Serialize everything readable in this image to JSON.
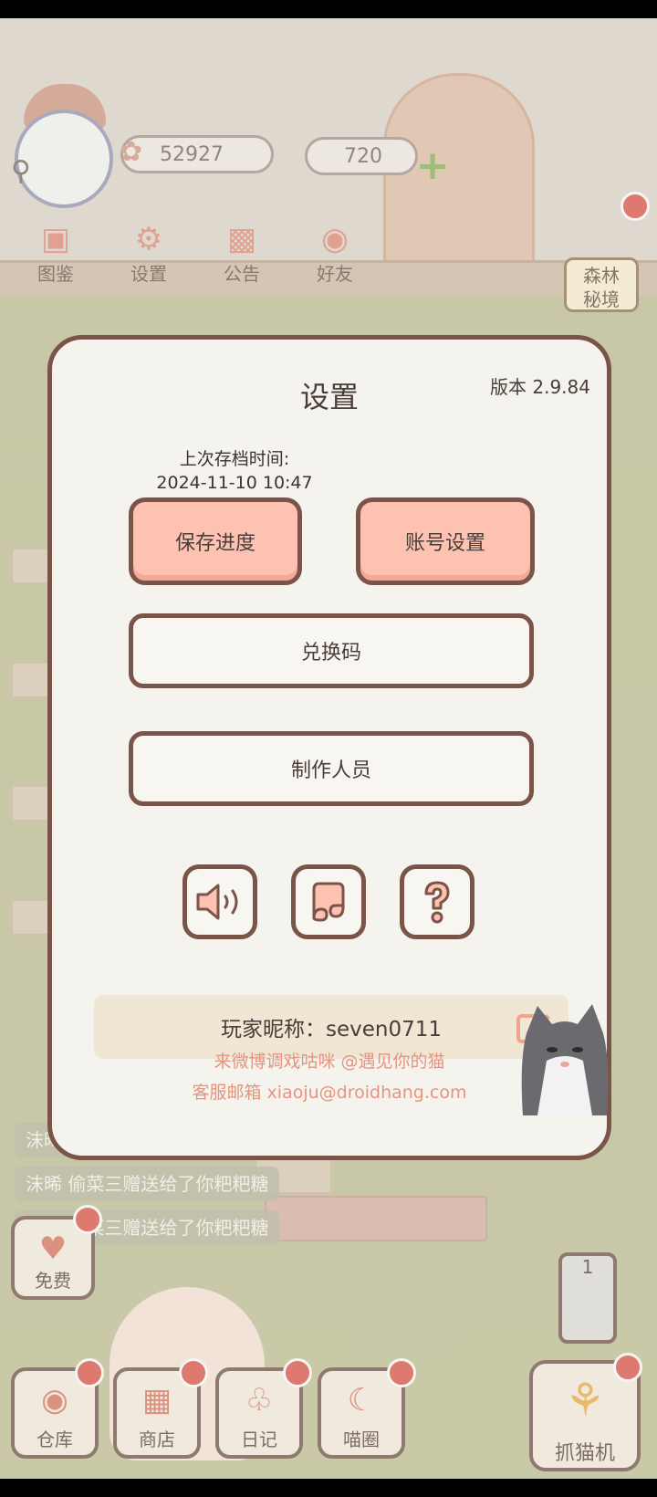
{
  "hud": {
    "fish_currency": "52927",
    "heart_currency": "720"
  },
  "top_nav": [
    {
      "label": "图鉴"
    },
    {
      "label": "设置"
    },
    {
      "label": "公告"
    },
    {
      "label": "好友"
    }
  ],
  "forest_label": "森林\n秘境",
  "forest_line1": "森林",
  "forest_line2": "秘境",
  "feed": [
    {
      "text": "沫晞"
    },
    {
      "text": "沫晞  偷菜三赠送给了你粑粑糖"
    },
    {
      "text": "沫晞  偷菜三赠送给了你粑粑糖"
    }
  ],
  "bottom_nav": [
    {
      "label": "免费"
    },
    {
      "label": "仓库"
    },
    {
      "label": "商店"
    },
    {
      "label": "日记"
    },
    {
      "label": "喵圈"
    },
    {
      "label": "抓猫机"
    }
  ],
  "counter_value": "1",
  "settings": {
    "title": "设置",
    "version": "版本 2.9.84",
    "last_save_label": "上次存档时间:",
    "last_save_time": "2024-11-10 10:47",
    "save_button": "保存进度",
    "account_button": "账号设置",
    "redeem_button": "兑换码",
    "credits_button": "制作人员",
    "nickname": "玩家昵称：seven0711",
    "weibo_text": "来微博调戏咕咪 @遇见你的猫",
    "email_text": "客服邮箱 xiaoju@droidhang.com"
  },
  "colors": {
    "accent_pink": "#fdc2b2",
    "border_brown": "#7a5448",
    "link_salmon": "#e5947e"
  },
  "icons": [
    "sound-icon",
    "music-icon",
    "help-icon",
    "edit-icon",
    "fish-icon",
    "plus-icon"
  ]
}
